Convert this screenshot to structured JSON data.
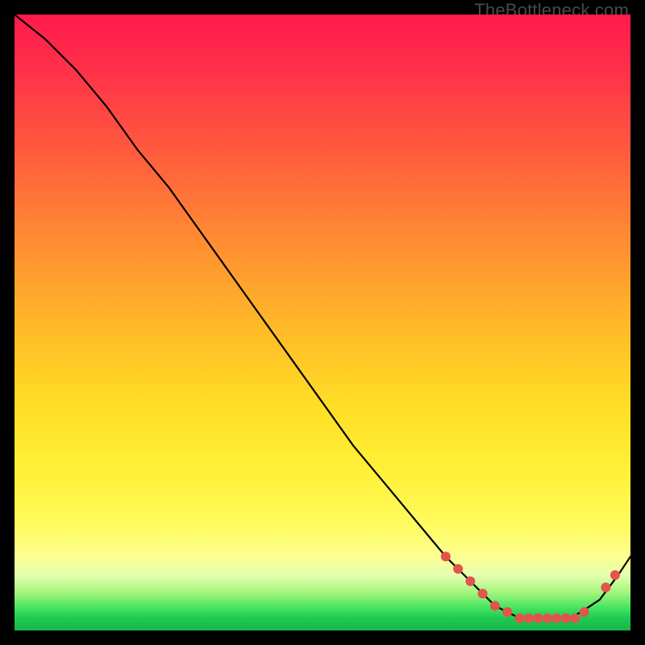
{
  "watermark": "TheBottleneck.com",
  "chart_data": {
    "type": "line",
    "title": "",
    "xlabel": "",
    "ylabel": "",
    "xlim": [
      0,
      100
    ],
    "ylim": [
      0,
      100
    ],
    "series": [
      {
        "name": "curve",
        "x": [
          0,
          5,
          10,
          15,
          20,
          25,
          30,
          35,
          40,
          45,
          50,
          55,
          60,
          65,
          70,
          72,
          75,
          78,
          80,
          82,
          85,
          88,
          90,
          92,
          95,
          98,
          100
        ],
        "y": [
          100,
          96,
          91,
          85,
          78,
          72,
          65,
          58,
          51,
          44,
          37,
          30,
          24,
          18,
          12,
          10,
          7,
          4,
          3,
          2,
          2,
          2,
          2,
          3,
          5,
          9,
          12
        ]
      }
    ],
    "markers": [
      {
        "x": 70,
        "y": 12
      },
      {
        "x": 72,
        "y": 10
      },
      {
        "x": 74,
        "y": 8
      },
      {
        "x": 76,
        "y": 6
      },
      {
        "x": 78,
        "y": 4
      },
      {
        "x": 80,
        "y": 3
      },
      {
        "x": 82,
        "y": 2
      },
      {
        "x": 83.5,
        "y": 2
      },
      {
        "x": 85,
        "y": 2
      },
      {
        "x": 86.5,
        "y": 2
      },
      {
        "x": 88,
        "y": 2
      },
      {
        "x": 89.5,
        "y": 2
      },
      {
        "x": 91,
        "y": 2
      },
      {
        "x": 92.5,
        "y": 3
      },
      {
        "x": 96,
        "y": 7
      },
      {
        "x": 97.5,
        "y": 9
      }
    ],
    "colors": {
      "line": "#000000",
      "marker": "#e2544c"
    }
  }
}
